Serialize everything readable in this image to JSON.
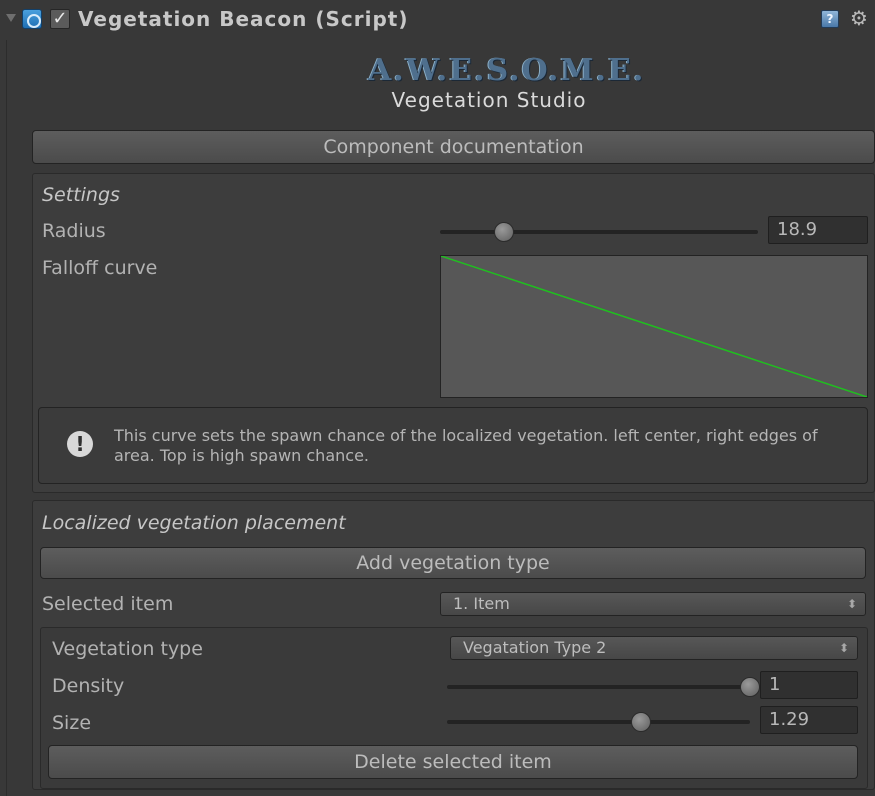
{
  "header": {
    "enabled_check": "✓",
    "title": "Vegetation Beacon (Script)",
    "help_glyph": "?",
    "gear_glyph": "⚙"
  },
  "logo": {
    "mark": "A.W.E.S.O.M.E.",
    "subtitle": "Vegetation Studio"
  },
  "buttons": {
    "documentation": "Component documentation",
    "add_vegetation": "Add vegetation type",
    "delete_item": "Delete selected item"
  },
  "settings": {
    "section_title": "Settings",
    "radius_label": "Radius",
    "radius_value": "18.9",
    "radius_fraction": 0.2,
    "falloff_label": "Falloff curve",
    "curve_color": "#1fbf1f",
    "help_glyph": "!",
    "help_text": "This curve sets the spawn chance of the localized vegetation. left center, right edges of area. Top is high spawn chance."
  },
  "placement": {
    "section_title": "Localized vegetation placement",
    "selected_item_label": "Selected item",
    "selected_item_value": "1. Item",
    "vegetation_type_label": "Vegetation type",
    "vegetation_type_value": "Vegatation Type 2",
    "density_label": "Density",
    "density_value": "1",
    "density_fraction": 1.0,
    "size_label": "Size",
    "size_value": "1.29",
    "size_fraction": 0.64,
    "dropdown_glyph": "⬍"
  }
}
